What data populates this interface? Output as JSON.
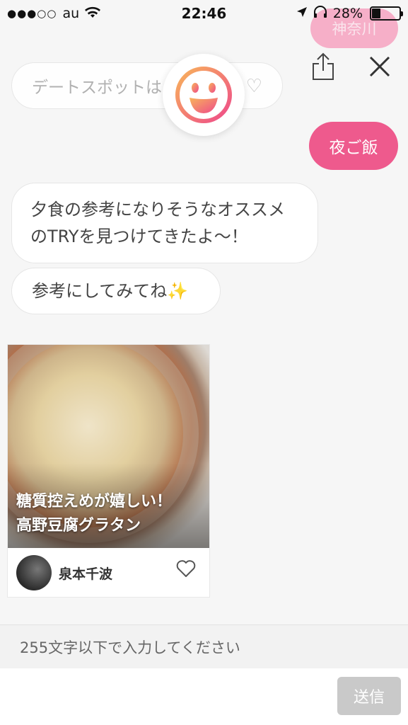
{
  "status": {
    "signal": "●●●○○",
    "carrier": "au",
    "time": "22:46",
    "battery": "28%"
  },
  "top": {
    "faded_chip": "神奈川",
    "search_placeholder": "デートスポットは",
    "heart": "♡"
  },
  "chat": {
    "user_message": "夜ご飯",
    "bot_message_1": "夕食の参考になりそうなオススメのTRYを見つけてきたよ〜！",
    "bot_message_2": "参考にしてみてね✨"
  },
  "card": {
    "title_line1": "糖質控えめが嬉しい！",
    "title_line2": "高野豆腐グラタン",
    "author": "泉本千波"
  },
  "input": {
    "placeholder": "255文字以下で入力してください",
    "send_label": "送信"
  },
  "colors": {
    "accent_pink": "#ee5a8d",
    "send_disabled": "#c9c9c9"
  }
}
